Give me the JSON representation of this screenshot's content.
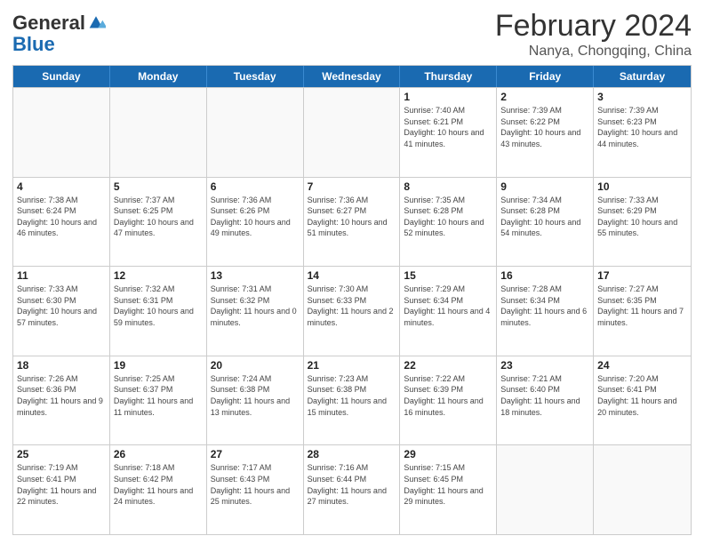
{
  "header": {
    "logo_line1": "General",
    "logo_line2": "Blue",
    "title": "February 2024",
    "subtitle": "Nanya, Chongqing, China"
  },
  "days_of_week": [
    "Sunday",
    "Monday",
    "Tuesday",
    "Wednesday",
    "Thursday",
    "Friday",
    "Saturday"
  ],
  "weeks": [
    [
      {
        "day": "",
        "empty": true
      },
      {
        "day": "",
        "empty": true
      },
      {
        "day": "",
        "empty": true
      },
      {
        "day": "",
        "empty": true
      },
      {
        "day": "1",
        "sunrise": "7:40 AM",
        "sunset": "6:21 PM",
        "daylight": "10 hours and 41 minutes."
      },
      {
        "day": "2",
        "sunrise": "7:39 AM",
        "sunset": "6:22 PM",
        "daylight": "10 hours and 43 minutes."
      },
      {
        "day": "3",
        "sunrise": "7:39 AM",
        "sunset": "6:23 PM",
        "daylight": "10 hours and 44 minutes."
      }
    ],
    [
      {
        "day": "4",
        "sunrise": "7:38 AM",
        "sunset": "6:24 PM",
        "daylight": "10 hours and 46 minutes."
      },
      {
        "day": "5",
        "sunrise": "7:37 AM",
        "sunset": "6:25 PM",
        "daylight": "10 hours and 47 minutes."
      },
      {
        "day": "6",
        "sunrise": "7:36 AM",
        "sunset": "6:26 PM",
        "daylight": "10 hours and 49 minutes."
      },
      {
        "day": "7",
        "sunrise": "7:36 AM",
        "sunset": "6:27 PM",
        "daylight": "10 hours and 51 minutes."
      },
      {
        "day": "8",
        "sunrise": "7:35 AM",
        "sunset": "6:28 PM",
        "daylight": "10 hours and 52 minutes."
      },
      {
        "day": "9",
        "sunrise": "7:34 AM",
        "sunset": "6:28 PM",
        "daylight": "10 hours and 54 minutes."
      },
      {
        "day": "10",
        "sunrise": "7:33 AM",
        "sunset": "6:29 PM",
        "daylight": "10 hours and 55 minutes."
      }
    ],
    [
      {
        "day": "11",
        "sunrise": "7:33 AM",
        "sunset": "6:30 PM",
        "daylight": "10 hours and 57 minutes."
      },
      {
        "day": "12",
        "sunrise": "7:32 AM",
        "sunset": "6:31 PM",
        "daylight": "10 hours and 59 minutes."
      },
      {
        "day": "13",
        "sunrise": "7:31 AM",
        "sunset": "6:32 PM",
        "daylight": "11 hours and 0 minutes."
      },
      {
        "day": "14",
        "sunrise": "7:30 AM",
        "sunset": "6:33 PM",
        "daylight": "11 hours and 2 minutes."
      },
      {
        "day": "15",
        "sunrise": "7:29 AM",
        "sunset": "6:34 PM",
        "daylight": "11 hours and 4 minutes."
      },
      {
        "day": "16",
        "sunrise": "7:28 AM",
        "sunset": "6:34 PM",
        "daylight": "11 hours and 6 minutes."
      },
      {
        "day": "17",
        "sunrise": "7:27 AM",
        "sunset": "6:35 PM",
        "daylight": "11 hours and 7 minutes."
      }
    ],
    [
      {
        "day": "18",
        "sunrise": "7:26 AM",
        "sunset": "6:36 PM",
        "daylight": "11 hours and 9 minutes."
      },
      {
        "day": "19",
        "sunrise": "7:25 AM",
        "sunset": "6:37 PM",
        "daylight": "11 hours and 11 minutes."
      },
      {
        "day": "20",
        "sunrise": "7:24 AM",
        "sunset": "6:38 PM",
        "daylight": "11 hours and 13 minutes."
      },
      {
        "day": "21",
        "sunrise": "7:23 AM",
        "sunset": "6:38 PM",
        "daylight": "11 hours and 15 minutes."
      },
      {
        "day": "22",
        "sunrise": "7:22 AM",
        "sunset": "6:39 PM",
        "daylight": "11 hours and 16 minutes."
      },
      {
        "day": "23",
        "sunrise": "7:21 AM",
        "sunset": "6:40 PM",
        "daylight": "11 hours and 18 minutes."
      },
      {
        "day": "24",
        "sunrise": "7:20 AM",
        "sunset": "6:41 PM",
        "daylight": "11 hours and 20 minutes."
      }
    ],
    [
      {
        "day": "25",
        "sunrise": "7:19 AM",
        "sunset": "6:41 PM",
        "daylight": "11 hours and 22 minutes."
      },
      {
        "day": "26",
        "sunrise": "7:18 AM",
        "sunset": "6:42 PM",
        "daylight": "11 hours and 24 minutes."
      },
      {
        "day": "27",
        "sunrise": "7:17 AM",
        "sunset": "6:43 PM",
        "daylight": "11 hours and 25 minutes."
      },
      {
        "day": "28",
        "sunrise": "7:16 AM",
        "sunset": "6:44 PM",
        "daylight": "11 hours and 27 minutes."
      },
      {
        "day": "29",
        "sunrise": "7:15 AM",
        "sunset": "6:45 PM",
        "daylight": "11 hours and 29 minutes."
      },
      {
        "day": "",
        "empty": true
      },
      {
        "day": "",
        "empty": true
      }
    ]
  ]
}
